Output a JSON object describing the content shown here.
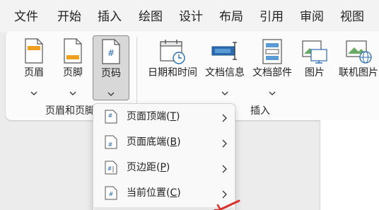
{
  "menubar": {
    "items": [
      "文件",
      "开始",
      "插入",
      "绘图",
      "设计",
      "布局",
      "引用",
      "审阅",
      "视图"
    ]
  },
  "ribbon": {
    "groups": [
      {
        "label": "页眉和页脚"
      },
      {
        "label": "插入"
      }
    ],
    "buttons": [
      {
        "label": "页眉",
        "icon": "header-icon"
      },
      {
        "label": "页脚",
        "icon": "footer-icon"
      },
      {
        "label": "页码",
        "icon": "page-number-icon"
      },
      {
        "label": "日期和时间",
        "icon": "date-time-icon"
      },
      {
        "label": "文档信息",
        "icon": "document-info-icon"
      },
      {
        "label": "文档部件",
        "icon": "document-parts-icon"
      },
      {
        "label": "图片",
        "icon": "picture-icon"
      },
      {
        "label": "联机图片",
        "icon": "online-picture-icon"
      }
    ]
  },
  "dropdown": {
    "items": [
      {
        "text": "页面顶端",
        "key": "T",
        "icon": "page-top-icon"
      },
      {
        "text": "页面底端",
        "key": "B",
        "icon": "page-bottom-icon"
      },
      {
        "text": "页边距",
        "key": "P",
        "icon": "page-margin-icon"
      },
      {
        "text": "当前位置",
        "key": "C",
        "icon": "current-position-icon"
      }
    ]
  },
  "colors": {
    "accent_blue": "#2b6cb0",
    "menu_bg": "#f3f3f3",
    "ribbon_bg": "#fbfbfb",
    "pen_red": "#d9302c"
  }
}
